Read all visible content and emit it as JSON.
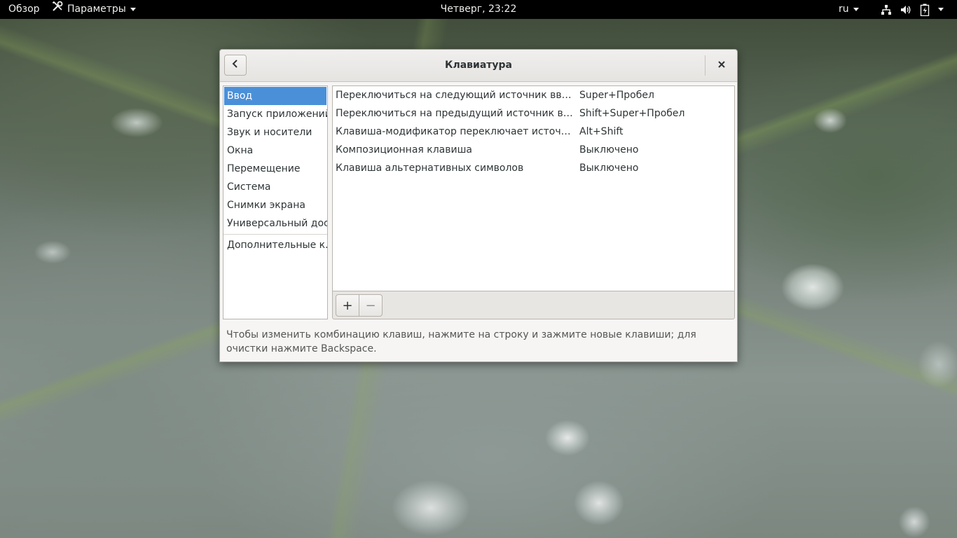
{
  "topbar": {
    "activities": "Обзор",
    "app_menu": "Параметры",
    "clock": "Четверг, 23:22",
    "language": "ru",
    "icons": [
      "network-icon",
      "volume-icon",
      "battery-icon",
      "chevron-down-icon"
    ]
  },
  "dialog": {
    "title": "Клавиатура",
    "sidebar": [
      {
        "label": "Ввод",
        "selected": true
      },
      {
        "label": "Запуск приложений"
      },
      {
        "label": "Звук и носители"
      },
      {
        "label": "Окна"
      },
      {
        "label": "Перемещение"
      },
      {
        "label": "Система"
      },
      {
        "label": "Снимки экрана"
      },
      {
        "label": "Универсальный дос..."
      },
      {
        "label": "Дополнительные к..."
      }
    ],
    "shortcuts": [
      {
        "name": "Переключиться на следующий источник ввода",
        "accel": "Super+Пробел"
      },
      {
        "name": "Переключиться на предыдущий источник ввода",
        "accel": "Shift+Super+Пробел"
      },
      {
        "name": "Клавиша-модификатор переключает источник вв...",
        "accel": "Alt+Shift"
      },
      {
        "name": "Композиционная клавиша",
        "accel": "Выключено"
      },
      {
        "name": "Клавиша альтернативных символов",
        "accel": "Выключено"
      }
    ],
    "add_label": "+",
    "remove_label": "−",
    "hint": "Чтобы изменить комбинацию клавиш, нажмите на строку и зажмите новые клавиши; для очистки нажмите Backspace."
  },
  "colors": {
    "topbar_bg": "#000000",
    "selection": "#4a90d9",
    "dialog_bg": "#f6f5f4"
  }
}
